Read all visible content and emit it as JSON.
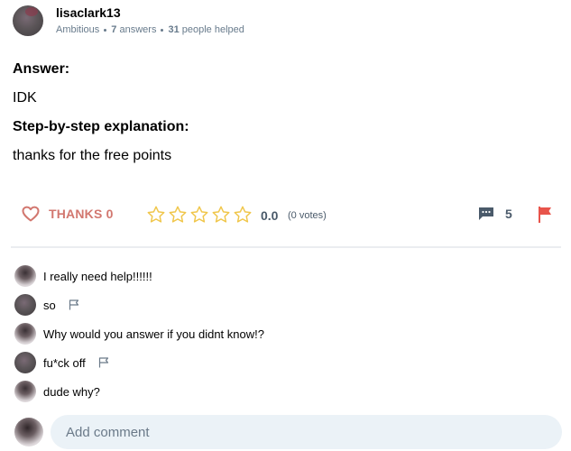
{
  "author": {
    "username": "lisaclark13",
    "rank": "Ambitious",
    "answers_count": "7",
    "answers_label": "answers",
    "helped_count": "31",
    "helped_label": "people helped"
  },
  "answer": {
    "answer_heading": "Answer:",
    "answer_text": "IDK",
    "explanation_heading": "Step-by-step explanation:",
    "explanation_text": "thanks for the free points"
  },
  "actions": {
    "thanks_label": "THANKS 0",
    "rating_value": "0.0",
    "votes_label": "(0 votes)",
    "stars_filled": 0,
    "stars_total": 5,
    "comments_count": "5",
    "colors": {
      "thanks": "#d2776f",
      "star": "#f0c64a",
      "flag": "#e8544b",
      "neutral": "#4a5a6a"
    }
  },
  "comments": [
    {
      "text": "I really need help!!!!!!",
      "avatar": "user-a",
      "flaggable": false
    },
    {
      "text": "so",
      "avatar": "user-b",
      "flaggable": true
    },
    {
      "text": "Why would you answer if you didnt know!?",
      "avatar": "user-a",
      "flaggable": false
    },
    {
      "text": "fu*ck off",
      "avatar": "user-b",
      "flaggable": true
    },
    {
      "text": "dude why?",
      "avatar": "user-a",
      "flaggable": false
    }
  ],
  "add_comment": {
    "placeholder": "Add comment",
    "value": ""
  }
}
